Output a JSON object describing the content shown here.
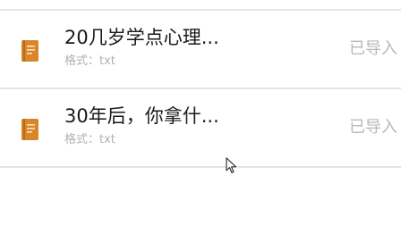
{
  "book_list": {
    "items": [
      {
        "title": "20几岁学点心理...",
        "format_label": "格式：",
        "format_value": "txt",
        "status": "已导入"
      },
      {
        "title": "30年后，你拿什...",
        "format_label": "格式：",
        "format_value": "txt",
        "status": "已导入"
      }
    ],
    "icon": "book-icon",
    "colors": {
      "book_icon": "#d9852a",
      "title": "#1a1a1a",
      "meta": "#b0b0b0",
      "status": "#b8b8b8",
      "divider": "#e4e4e4"
    }
  }
}
